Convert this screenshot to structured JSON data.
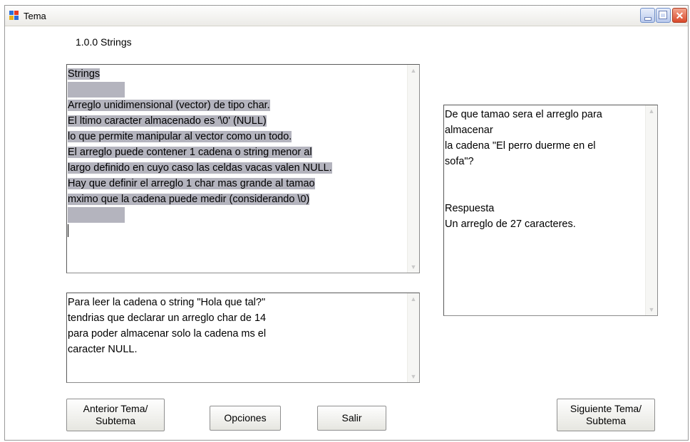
{
  "window": {
    "title": "Tema"
  },
  "topic_label": "1.0.0  Strings",
  "main_text": {
    "lines": [
      "Strings",
      "",
      "Arreglo unidimensional (vector) de tipo char.",
      "El ltimo caracter almacenado es '\\0' (NULL)",
      "lo que permite manipular al vector como un todo.",
      "El arreglo puede contener 1 cadena o string menor al",
      "largo definido en cuyo caso las celdas vacas valen NULL.",
      "Hay que definir el arreglo 1 char mas grande al tamao",
      "mximo que la cadena puede medir (considerando \\0)",
      ""
    ]
  },
  "example_text": {
    "lines": [
      "Para leer la cadena o string \"Hola que tal?\"",
      "tendrias que declarar un arreglo char de 14",
      "para poder almacenar solo la cadena ms el",
      "caracter NULL."
    ]
  },
  "question_text": {
    "lines": [
      "De que tamao sera el arreglo para",
      "almacenar",
      "la cadena \"El perro duerme en el",
      "sofa\"?",
      "",
      "",
      "Respuesta",
      "Un arreglo de 27 caracteres."
    ]
  },
  "buttons": {
    "previous": "Anterior Tema/\nSubtema",
    "options": "Opciones",
    "exit": "Salir",
    "next": "Siguiente Tema/\nSubtema"
  },
  "colors": {
    "selection": "#b4b4be",
    "scroll_arrow": "#c9c9c9"
  },
  "icons": [
    "app-icon",
    "minimize-icon",
    "maximize-icon",
    "close-icon",
    "scroll-up-arrow",
    "scroll-down-arrow"
  ]
}
